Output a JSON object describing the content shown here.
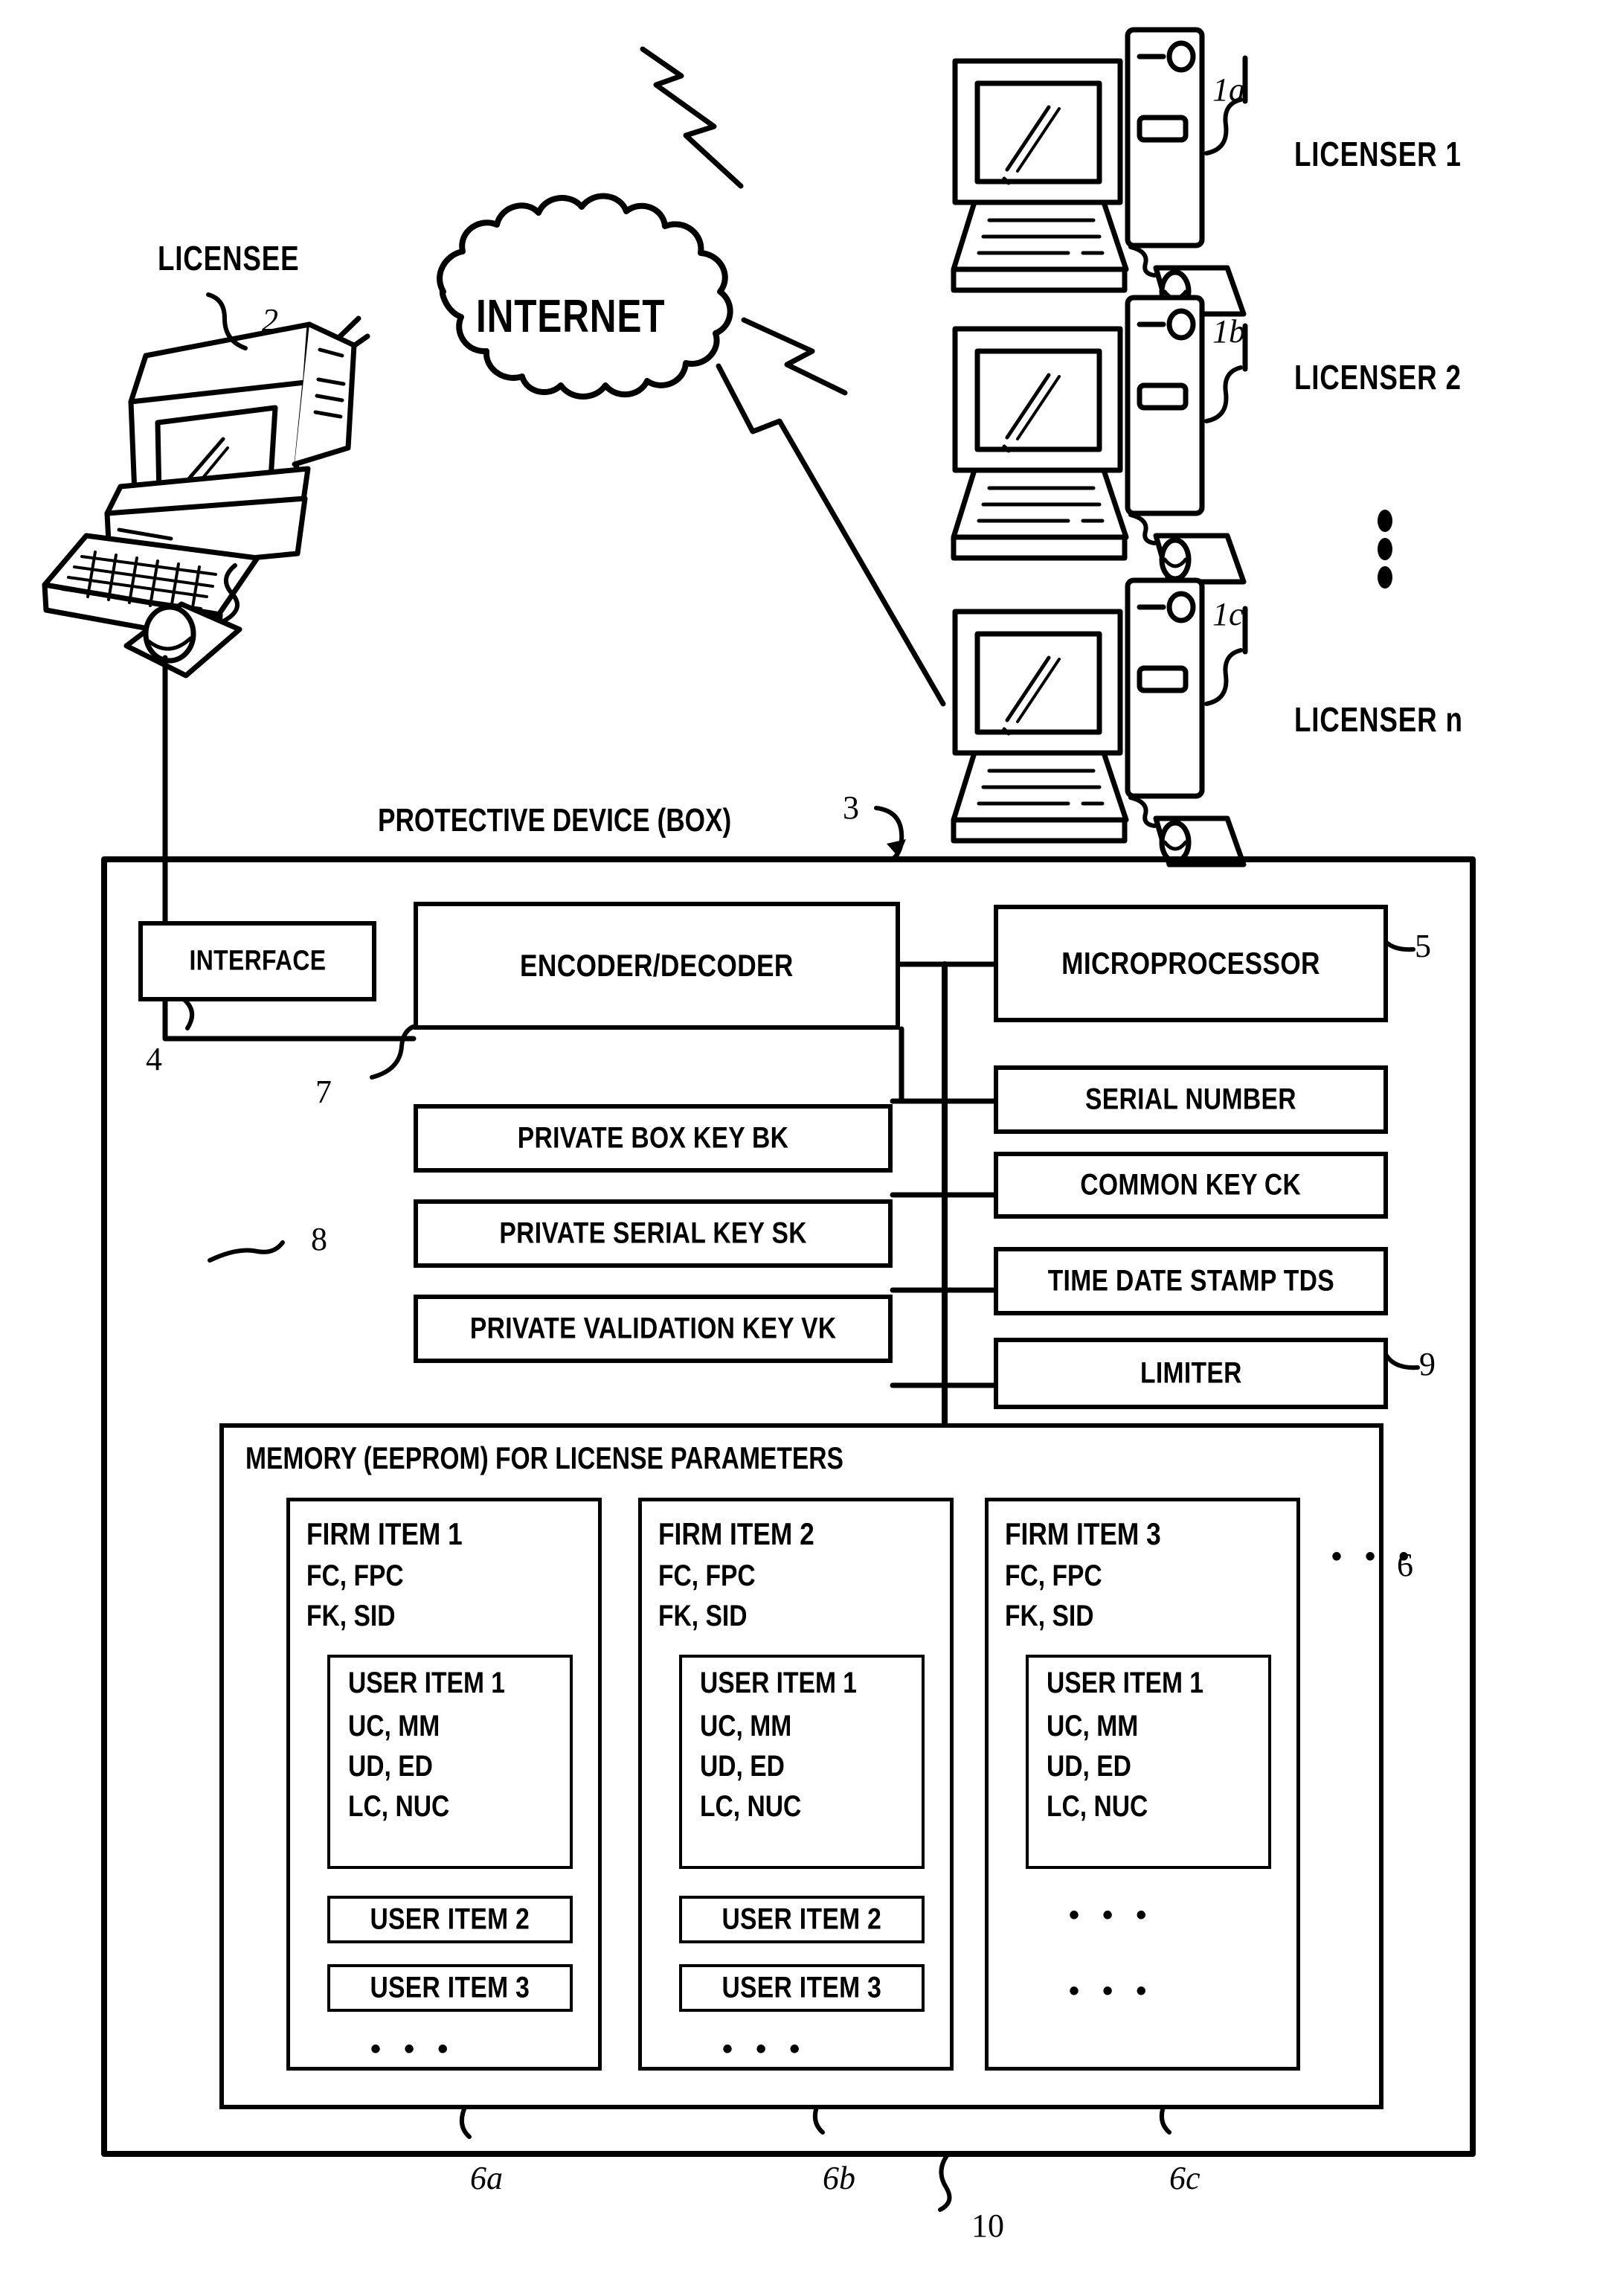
{
  "diagram": {
    "title_internet": "INTERNET",
    "licensee_label": "LICENSEE",
    "licensee_ref": "2",
    "licensers": [
      {
        "name": "LICENSER 1",
        "ref": "1a"
      },
      {
        "name": "LICENSER 2",
        "ref": "1b"
      },
      {
        "name": "LICENSER n",
        "ref": "1c"
      }
    ],
    "vertical_ellipsis": "•",
    "device": {
      "caption": "PROTECTIVE DEVICE (BOX)",
      "caption_ref": "3",
      "outer_ref": "10",
      "interface": {
        "label": "INTERFACE",
        "ref": "4"
      },
      "encoder": {
        "label": "ENCODER/DECODER",
        "ref": "7"
      },
      "keys_ref": "8",
      "keys": [
        "PRIVATE BOX KEY BK",
        "PRIVATE SERIAL KEY SK",
        "PRIVATE VALIDATION KEY VK"
      ],
      "right_column": [
        {
          "label": "MICROPROCESSOR",
          "ref": "5"
        },
        {
          "label": "SERIAL NUMBER",
          "ref": ""
        },
        {
          "label": "COMMON KEY CK",
          "ref": ""
        },
        {
          "label": "TIME DATE STAMP TDS",
          "ref": ""
        },
        {
          "label": "LIMITER",
          "ref": "9"
        }
      ],
      "memory": {
        "caption": "MEMORY (EEPROM) FOR LICENSE PARAMETERS",
        "ref": "6",
        "ellipsis": "• • •",
        "firm_items": [
          {
            "title": "FIRM ITEM 1",
            "lines": [
              "FC, FPC",
              "FK, SID"
            ],
            "ref": "6a",
            "user_item_detail": {
              "title": "USER ITEM 1",
              "lines": [
                "UC, MM",
                "UD, ED",
                "LC, NUC"
              ]
            },
            "user_items": [
              "USER ITEM 2",
              "USER ITEM 3"
            ],
            "tail_ellipsis": "• • •",
            "extra_ellipsis": []
          },
          {
            "title": "FIRM ITEM 2",
            "lines": [
              "FC, FPC",
              "FK, SID"
            ],
            "ref": "6b",
            "user_item_detail": {
              "title": "USER ITEM 1",
              "lines": [
                "UC, MM",
                "UD, ED",
                "LC, NUC"
              ]
            },
            "user_items": [
              "USER ITEM 2",
              "USER ITEM 3"
            ],
            "tail_ellipsis": "• • •",
            "extra_ellipsis": []
          },
          {
            "title": "FIRM ITEM 3",
            "lines": [
              "FC, FPC",
              "FK, SID"
            ],
            "ref": "6c",
            "user_item_detail": {
              "title": "USER ITEM 1",
              "lines": [
                "UC, MM",
                "UD, ED",
                "LC, NUC"
              ]
            },
            "user_items": [],
            "tail_ellipsis": "• • •",
            "extra_ellipsis": [
              "• • •",
              "• • •"
            ]
          }
        ]
      }
    }
  }
}
